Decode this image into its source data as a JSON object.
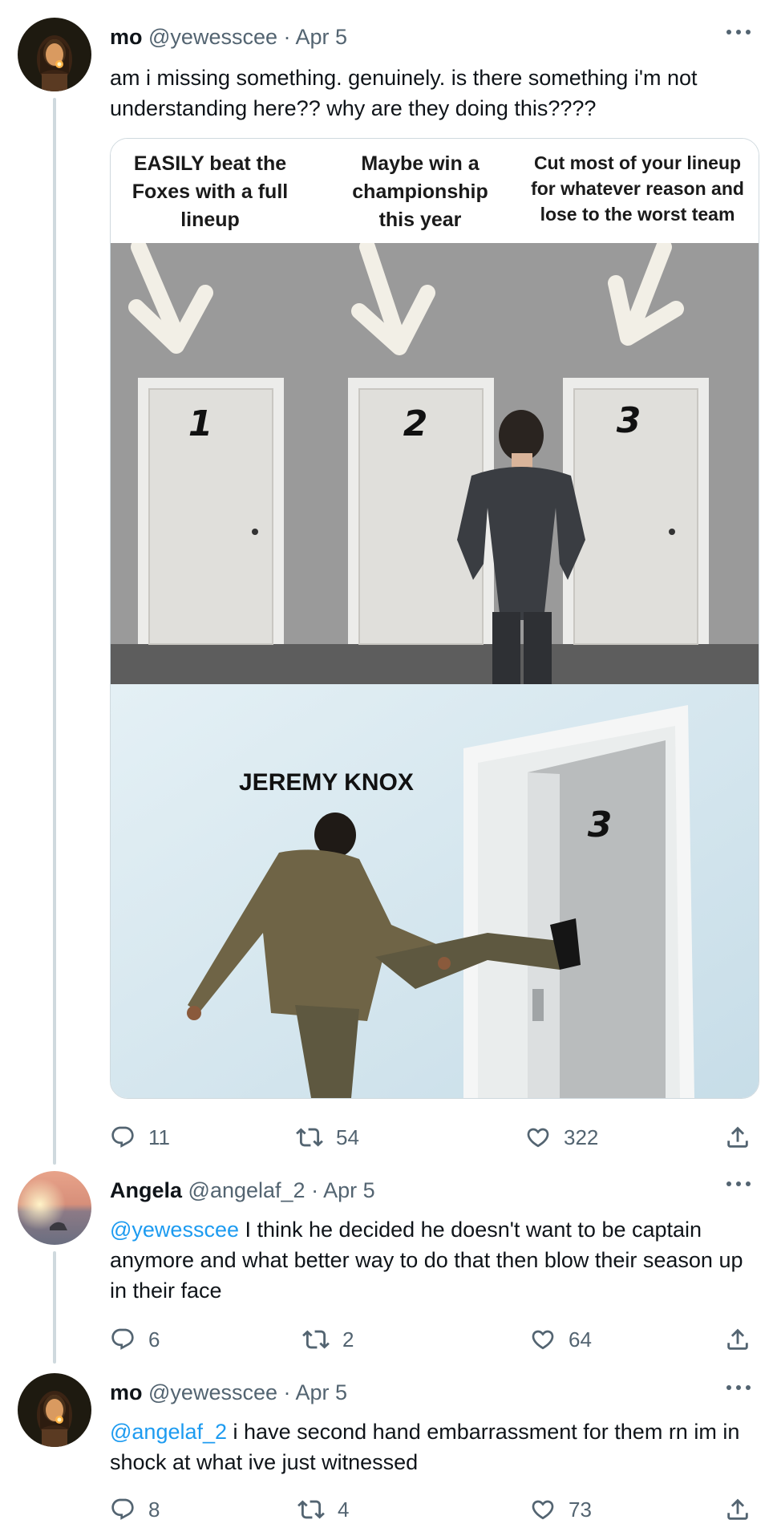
{
  "tweets": [
    {
      "name": "mo",
      "handle": "@yewesscee",
      "date": "Apr 5",
      "text": "am i missing something. genuinely. is there something i'm not understanding here?? why are they doing this????",
      "media": {
        "captions": [
          "EASILY beat the Foxes with a full lineup",
          "Maybe win a championship this year",
          "Cut most of your lineup for whatever reason and lose to the worst team"
        ],
        "door_numbers": [
          "1",
          "2",
          "3"
        ],
        "bottom_label": "JEREMY KNOX",
        "bottom_door_number": "3"
      },
      "replies": "11",
      "retweets": "54",
      "likes": "322"
    },
    {
      "name": "Angela",
      "handle": "@angelaf_2",
      "date": "Apr 5",
      "mention": "@yewesscee",
      "text": " I think he decided he doesn't want to be captain anymore and what better way to do that then blow their season up in their face",
      "replies": "6",
      "retweets": "2",
      "likes": "64"
    },
    {
      "name": "mo",
      "handle": "@yewesscee",
      "date": "Apr 5",
      "mention": "@angelaf_2",
      "text": " i have second hand embarrassment for them rn im in shock at what ive just witnessed",
      "replies": "8",
      "retweets": "4",
      "likes": "73"
    }
  ],
  "header_separator": " · ",
  "icons": {
    "reply": "reply-icon",
    "retweet": "retweet-icon",
    "like": "heart-icon",
    "share": "share-icon",
    "more": "more-icon"
  },
  "colors": {
    "text": "#0f1419",
    "secondary": "#536471",
    "link": "#1d9bf0",
    "thread_line": "#cfd9de"
  }
}
